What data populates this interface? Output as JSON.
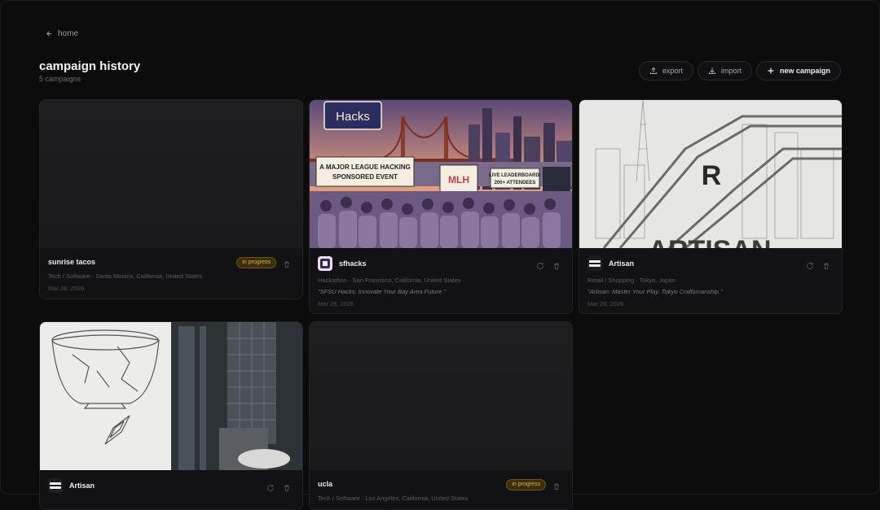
{
  "nav": {
    "back_label": "home"
  },
  "header": {
    "title": "campaign history",
    "subtitle": "5 campaigns"
  },
  "toolbar": {
    "export_label": "export",
    "import_label": "import",
    "new_label": "new campaign"
  },
  "colors": {
    "background": "#0c0c0d",
    "card": "#141416",
    "badge_text": "#e3b23c",
    "badge_bg": "#3a2f0a"
  },
  "campaigns": [
    {
      "name": "sunrise tacos",
      "status": "in progress",
      "meta": "Tech / Software · Santa Monica, California, United States",
      "tagline": "",
      "date": "Mar 28, 2026"
    },
    {
      "name": "sfhacks",
      "status": "",
      "meta": "Hackathon · San Francisco, California, United States",
      "tagline": "\"SFSU Hacks: Innovate Your Bay Area Future.\"",
      "date": "Mar 28, 2026",
      "thumb_text": {
        "sign": "Hacks",
        "banner1": "A MAJOR LEAGUE HACKING",
        "banner2": "SPONSORED EVENT",
        "mlh": "MLH",
        "board1": "LIVE LEADERBOARD:",
        "board2": "200+ ATTENDEES"
      }
    },
    {
      "name": "Artisan",
      "status": "",
      "meta": "Retail / Shopping · Tokyo, Japan",
      "tagline": "\"Artisan: Master Your Play. Tokyo Craftsmanship.\"",
      "date": "Mar 28, 2026",
      "thumb_text": {
        "logo": "R",
        "word": "ARTISAN"
      }
    },
    {
      "name": "Artisan",
      "status": "",
      "meta": "",
      "tagline": "",
      "date": ""
    },
    {
      "name": "ucla",
      "status": "in progress",
      "meta": "Tech / Software · Los Angeles, California, United States",
      "tagline": "",
      "date": ""
    }
  ],
  "icons": {
    "back": "arrow-left-icon",
    "export": "upload-icon",
    "import": "download-icon",
    "new": "plus-icon",
    "regenerate": "refresh-icon",
    "delete": "trash-icon"
  }
}
